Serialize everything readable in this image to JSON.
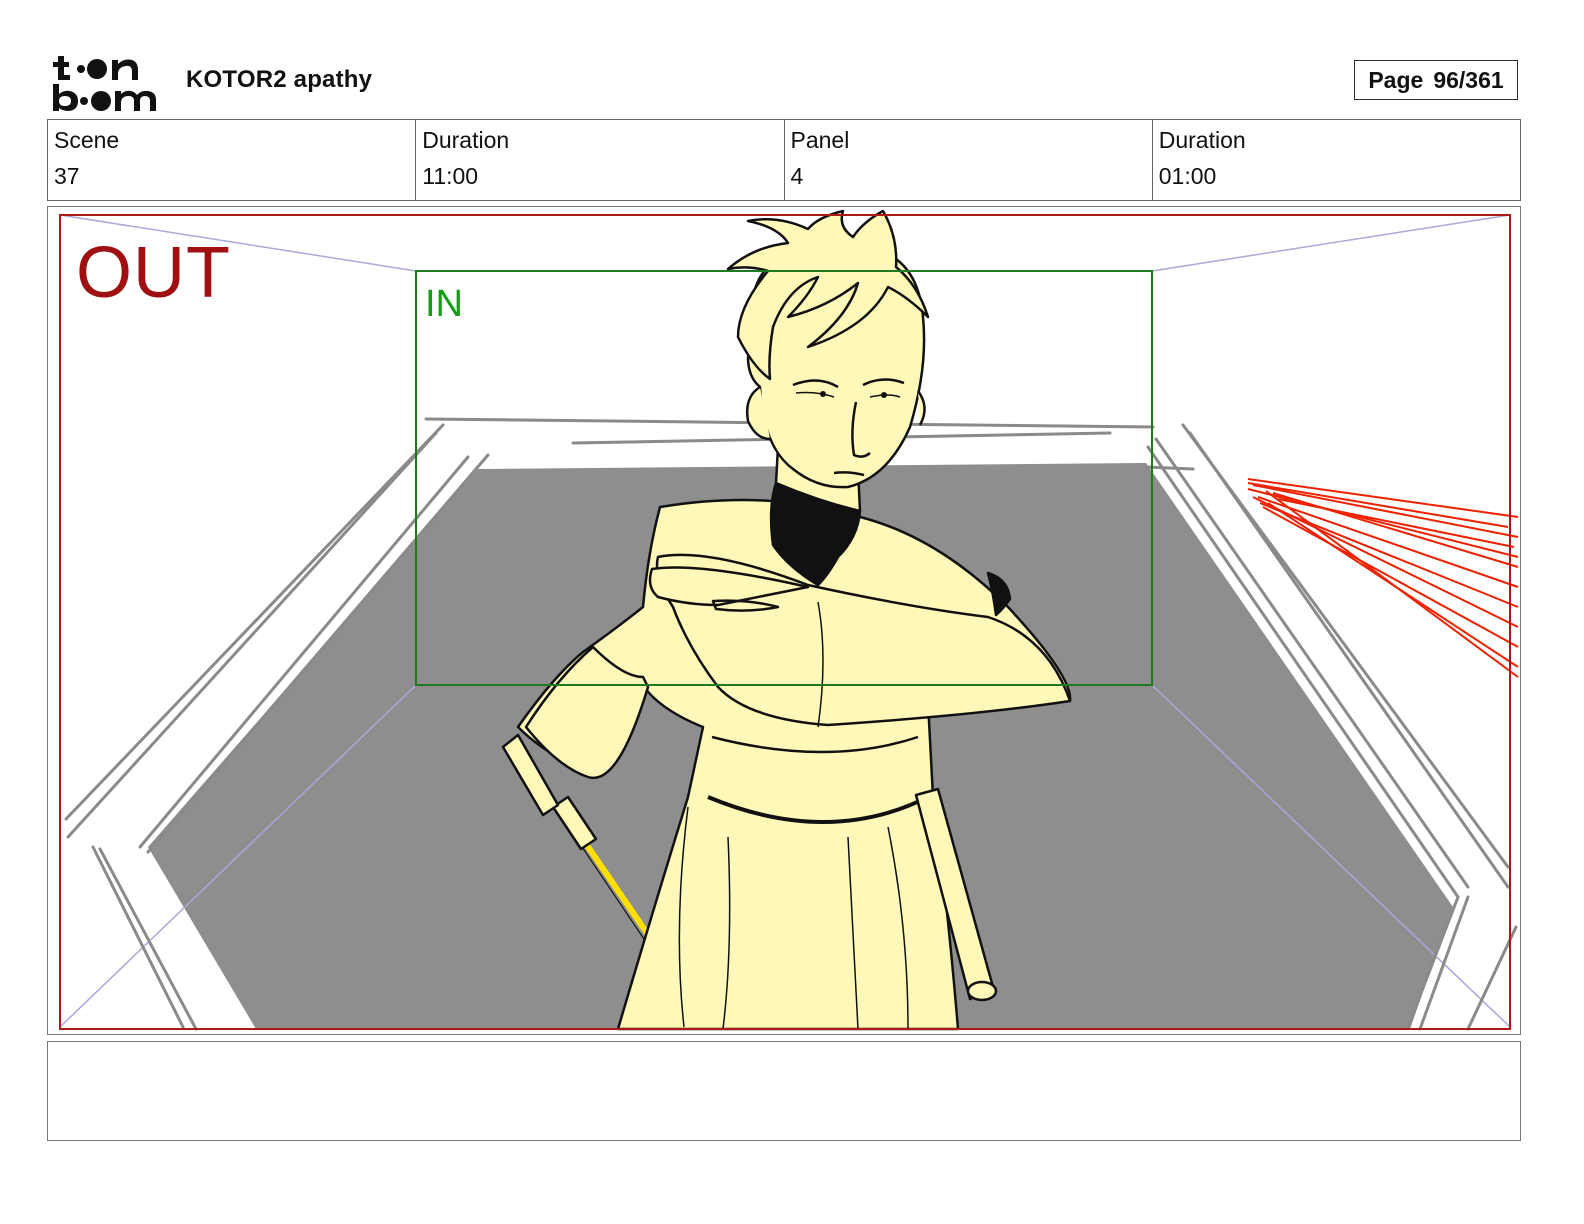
{
  "header": {
    "logo_text": "toon boom",
    "project_title": "KOTOR2 apathy",
    "page_label": "Page",
    "page_value": "96/361"
  },
  "info": {
    "scene_label": "Scene",
    "scene_value": "37",
    "duration_label": "Duration",
    "duration_value": "11:00",
    "panel_label": "Panel",
    "panel_value": "4",
    "panel_duration_label": "Duration",
    "panel_duration_value": "01:00"
  },
  "panel": {
    "out_label": "OUT",
    "in_label": "IN",
    "colors": {
      "out_frame": "#b01818",
      "in_frame": "#1e7a1e",
      "floor": "#8e8e8e",
      "character_fill": "#fff8b8",
      "lightsaber": "#ffe000",
      "red_scribble": "#ee2200"
    }
  },
  "notes": {
    "text": ""
  }
}
